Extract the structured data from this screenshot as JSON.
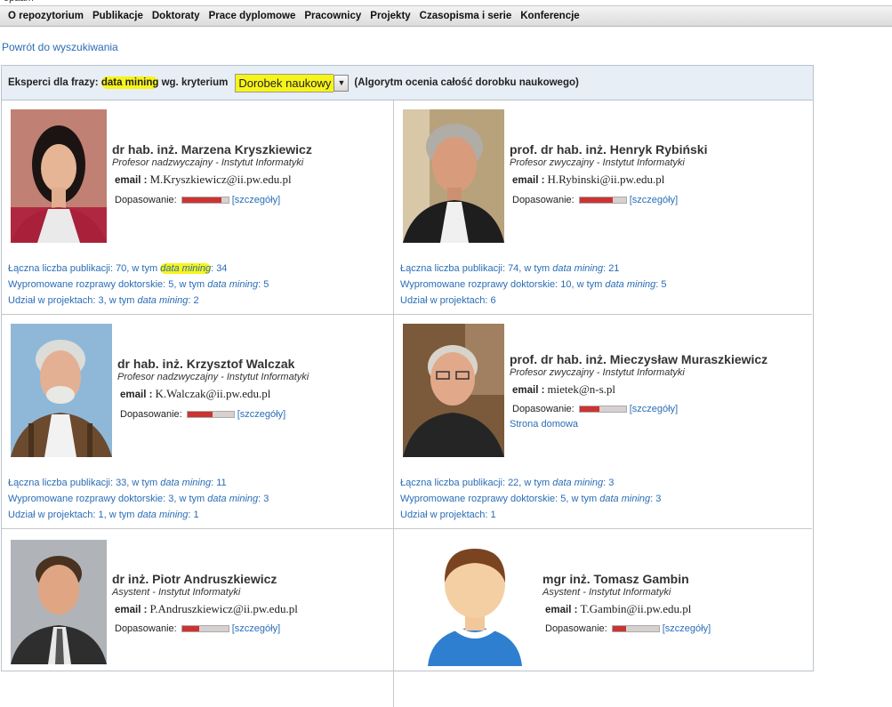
{
  "topcut": "opaam",
  "menu": [
    "O repozytorium",
    "Publikacje",
    "Doktoraty",
    "Prace dyplomowe",
    "Pracownicy",
    "Projekty",
    "Czasopisma i serie",
    "Konferencje"
  ],
  "back_link": "Powrót do wyszukiwania",
  "header": {
    "prefix": "Eksperci dla frazy:",
    "phrase": "data mining",
    "criterion_label": "wg. kryterium",
    "criterion_value": "Dorobek naukowy",
    "note": "(Algorytm ocenia całość dorobku naukowego)"
  },
  "labels": {
    "email": "email :",
    "match": "Dopasowanie:",
    "details": "[szczegóły]",
    "homepage": "Strona domowa"
  },
  "experts": [
    {
      "name": "dr hab. inż. Marzena Kryszkiewicz",
      "position": "Profesor nadzwyczajny - Instytut Informatyki",
      "email": "M.Kryszkiewicz@ii.pw.edu.pl",
      "match": 0.85,
      "pubs": "Łączna liczba publikacji: 70, w tym",
      "pubs_n": ": 34",
      "phd": "Wypromowane rozprawy doktorskie: 5, w tym",
      "phd_n": ": 5",
      "proj": "Udział w projektach: 3, w tym",
      "proj_n": ": 2"
    },
    {
      "name": "prof. dr hab. inż. Henryk Rybiński",
      "position": "Profesor zwyczajny - Instytut Informatyki",
      "email": "H.Rybinski@ii.pw.edu.pl",
      "match": 0.72,
      "pubs": "Łączna liczba publikacji: 74, w tym",
      "pubs_n": ": 21",
      "phd": "Wypromowane rozprawy doktorskie: 10, w tym",
      "phd_n": ": 5",
      "proj": "Udział w projektach: 6",
      "proj_n": ""
    },
    {
      "name": "dr hab. inż. Krzysztof Walczak",
      "position": "Profesor nadzwyczajny - Instytut Informatyki",
      "email": "K.Walczak@ii.pw.edu.pl",
      "match": 0.55,
      "pubs": "Łączna liczba publikacji: 33, w tym",
      "pubs_n": ": 11",
      "phd": "Wypromowane rozprawy doktorskie: 3, w tym",
      "phd_n": ": 3",
      "proj": "Udział w projektach: 1, w tym",
      "proj_n": ": 1"
    },
    {
      "name": "prof. dr hab. inż. Mieczysław Muraszkiewicz",
      "position": "Profesor zwyczajny - Instytut Informatyki",
      "email": "mietek@n-s.pl",
      "match": 0.42,
      "pubs": "Łączna liczba publikacji: 22, w tym",
      "pubs_n": ": 3",
      "phd": "Wypromowane rozprawy doktorskie: 5, w tym",
      "phd_n": ": 3",
      "proj": "Udział w projektach: 1",
      "proj_n": ""
    },
    {
      "name": "dr inż. Piotr Andruszkiewicz",
      "position": "Asystent - Instytut Informatyki",
      "email": "P.Andruszkiewicz@ii.pw.edu.pl",
      "match": 0.38
    },
    {
      "name": "mgr inż. Tomasz Gambin",
      "position": "Asystent - Instytut Informatyki",
      "email": "T.Gambin@ii.pw.edu.pl",
      "match": 0.3
    }
  ]
}
